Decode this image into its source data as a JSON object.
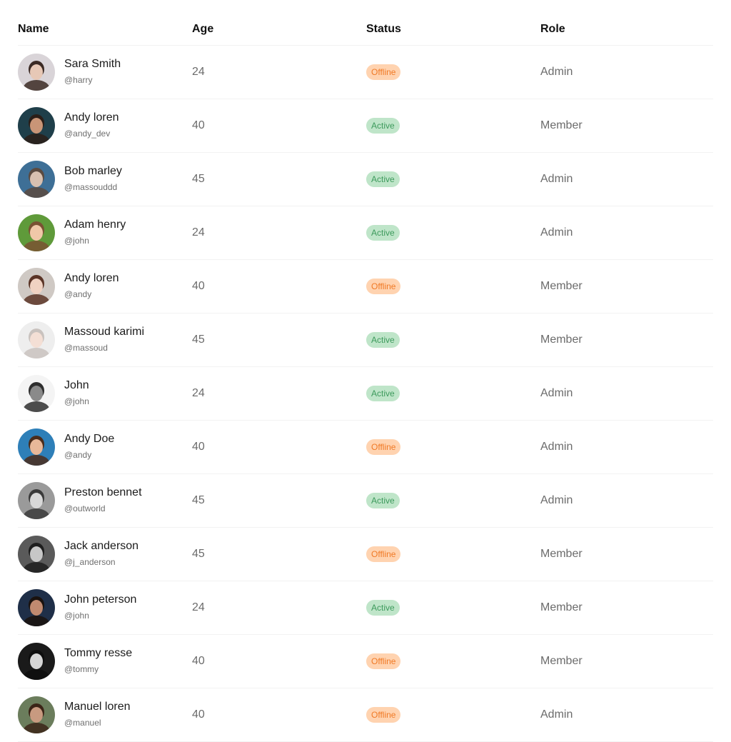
{
  "table": {
    "headers": {
      "name": "Name",
      "age": "Age",
      "status": "Status",
      "role": "Role"
    },
    "status_colors": {
      "active_bg": "#bfe5c9",
      "active_text": "#3d9a5c",
      "offline_bg": "#ffd3b0",
      "offline_text": "#f07a26"
    },
    "rows": [
      {
        "name": "Sara Smith",
        "handle": "@harry",
        "age": "24",
        "status": "Offline",
        "role": "Admin",
        "avatar": {
          "icon": "user-photo-avatar",
          "bg": "#d9d4d8",
          "face": "#e7c8b6",
          "hair": "#3b2a24"
        }
      },
      {
        "name": "Andy loren",
        "handle": "@andy_dev",
        "age": "40",
        "status": "Active",
        "role": "Member",
        "avatar": {
          "icon": "user-photo-avatar",
          "bg": "#1f3f4a",
          "face": "#c99577",
          "hair": "#2b1e18"
        }
      },
      {
        "name": "Bob marley",
        "handle": "@massouddd",
        "age": "45",
        "status": "Active",
        "role": "Admin",
        "avatar": {
          "icon": "user-photo-avatar",
          "bg": "#3e6f96",
          "face": "#d8c0b0",
          "hair": "#5b4a40"
        }
      },
      {
        "name": "Adam henry",
        "handle": "@john",
        "age": "24",
        "status": "Active",
        "role": "Admin",
        "avatar": {
          "icon": "user-photo-avatar",
          "bg": "#5f9a3a",
          "face": "#f0c8a8",
          "hair": "#7a5233"
        }
      },
      {
        "name": "Andy loren",
        "handle": "@andy",
        "age": "40",
        "status": "Offline",
        "role": "Member",
        "avatar": {
          "icon": "user-photo-avatar",
          "bg": "#cfc9c4",
          "face": "#f0d2c2",
          "hair": "#5a3426"
        }
      },
      {
        "name": "Massoud karimi",
        "handle": "@massoud",
        "age": "45",
        "status": "Active",
        "role": "Member",
        "avatar": {
          "icon": "user-photo-avatar",
          "bg": "#eeeeee",
          "face": "#f4dfd5",
          "hair": "#c9c2be"
        }
      },
      {
        "name": "John",
        "handle": "@john",
        "age": "24",
        "status": "Active",
        "role": "Admin",
        "avatar": {
          "icon": "user-photo-avatar",
          "bg": "#f4f4f4",
          "face": "#8a8a8a",
          "hair": "#2e2e2e"
        }
      },
      {
        "name": "Andy Doe",
        "handle": "@andy",
        "age": "40",
        "status": "Offline",
        "role": "Admin",
        "avatar": {
          "icon": "user-photo-avatar",
          "bg": "#2e7fb8",
          "face": "#e8b899",
          "hair": "#4a2c1b"
        }
      },
      {
        "name": "Preston bennet",
        "handle": "@outworld",
        "age": "45",
        "status": "Active",
        "role": "Admin",
        "avatar": {
          "icon": "user-photo-avatar",
          "bg": "#9a9a9a",
          "face": "#d8d8d8",
          "hair": "#3a3a3a"
        }
      },
      {
        "name": "Jack anderson",
        "handle": "@j_anderson",
        "age": "45",
        "status": "Offline",
        "role": "Member",
        "avatar": {
          "icon": "user-photo-avatar",
          "bg": "#5a5a5a",
          "face": "#c7c7c7",
          "hair": "#1e1e1e"
        }
      },
      {
        "name": "John peterson",
        "handle": "@john",
        "age": "24",
        "status": "Active",
        "role": "Member",
        "avatar": {
          "icon": "user-photo-avatar",
          "bg": "#1f2f48",
          "face": "#c08a70",
          "hair": "#1a120e"
        }
      },
      {
        "name": "Tommy resse",
        "handle": "@tommy",
        "age": "40",
        "status": "Offline",
        "role": "Member",
        "avatar": {
          "icon": "user-photo-avatar",
          "bg": "#1a1a1a",
          "face": "#d6d6d6",
          "hair": "#0e0e0e"
        }
      },
      {
        "name": "Manuel loren",
        "handle": "@manuel",
        "age": "40",
        "status": "Offline",
        "role": "Admin",
        "avatar": {
          "icon": "user-photo-avatar",
          "bg": "#6b7d5c",
          "face": "#c89a80",
          "hair": "#3b2417"
        }
      }
    ]
  }
}
